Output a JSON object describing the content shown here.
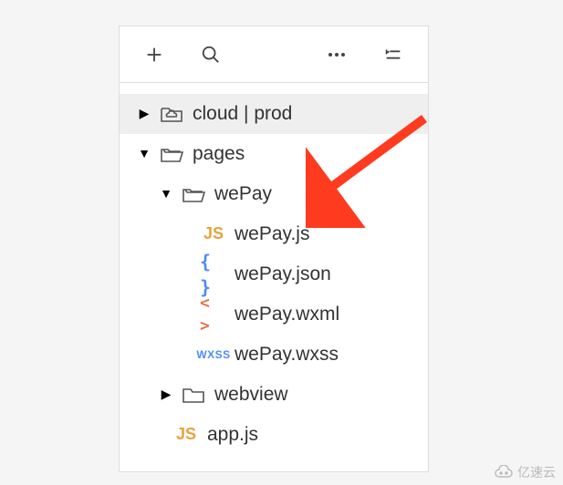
{
  "tree": {
    "root": {
      "label": "cloud | prod"
    },
    "pages": {
      "label": "pages"
    },
    "wepay_folder": {
      "label": "wePay"
    },
    "wepay_js": {
      "label": "wePay.js",
      "badge": "JS"
    },
    "wepay_json": {
      "label": "wePay.json",
      "badge": "{ }"
    },
    "wepay_wxml": {
      "label": "wePay.wxml",
      "badge": "< >"
    },
    "wepay_wxss": {
      "label": "wePay.wxss",
      "badge": "WXSS"
    },
    "webview": {
      "label": "webview"
    },
    "app_js": {
      "label": "app.js",
      "badge": "JS"
    }
  },
  "watermark": "亿速云"
}
